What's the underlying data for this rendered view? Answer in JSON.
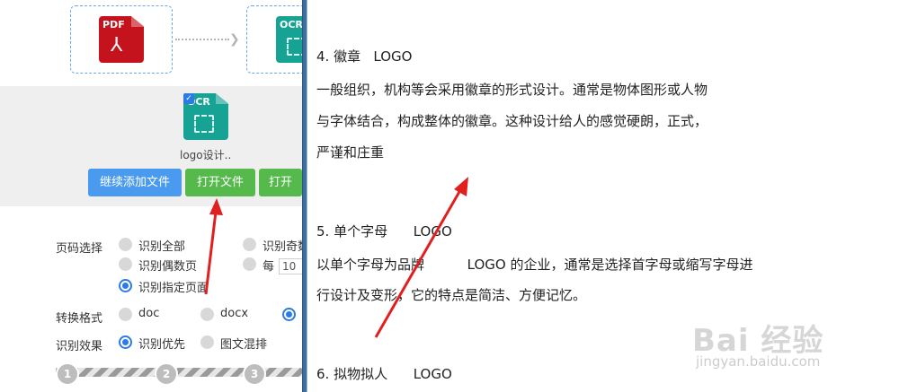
{
  "converter": {
    "source_file": {
      "badge": "PDF",
      "icon": "pdf-file-icon"
    },
    "target_file": {
      "badge": "OCR",
      "icon": "ocr-file-icon"
    },
    "selected_file": {
      "badge": "OCR",
      "name": "logo设计..",
      "checked": true
    },
    "buttons": {
      "continue_add": "继续添加文件",
      "open_file": "打开文件",
      "open_folder_partial": "打开文"
    },
    "page_select": {
      "label": "页码选择",
      "options": [
        "识别全部",
        "识别奇数",
        "识别偶数页",
        "每",
        "识别指定页面"
      ],
      "selected": "识别指定页面",
      "every_value": "10"
    },
    "format": {
      "label": "转换格式",
      "options": [
        "doc",
        "docx"
      ],
      "selected": "third-option"
    },
    "effect": {
      "label": "识别效果",
      "options": [
        "识别优先",
        "图文混排"
      ],
      "selected": "识别优先"
    },
    "steps": [
      "1",
      "2",
      "3"
    ]
  },
  "document": {
    "lines": [
      "4. 徽章   LOGO",
      "一般组织，机构等会采用徽章的形式设计。通常是物体图形或人物",
      "与字体结合，构成整体的徽章。这种设计给人的感觉硬朗，正式，",
      "严谨和庄重",
      "5. 单个字母      LOGO",
      "以单个字母为品牌          LOGO 的企业，通常是选择首字母或缩写字母进",
      "行设计及变形，它的特点是简洁、方便记忆。",
      "6. 拟物拟人      LOGO"
    ]
  },
  "watermark": {
    "brand": "Bai 经验",
    "url": "jingyan.baidu.com"
  },
  "colors": {
    "accent_blue": "#4a9bf0",
    "open_green": "#55b94c",
    "pdf_red": "#c5131d",
    "ocr_teal": "#16a394",
    "arrow_red": "#e02020"
  }
}
